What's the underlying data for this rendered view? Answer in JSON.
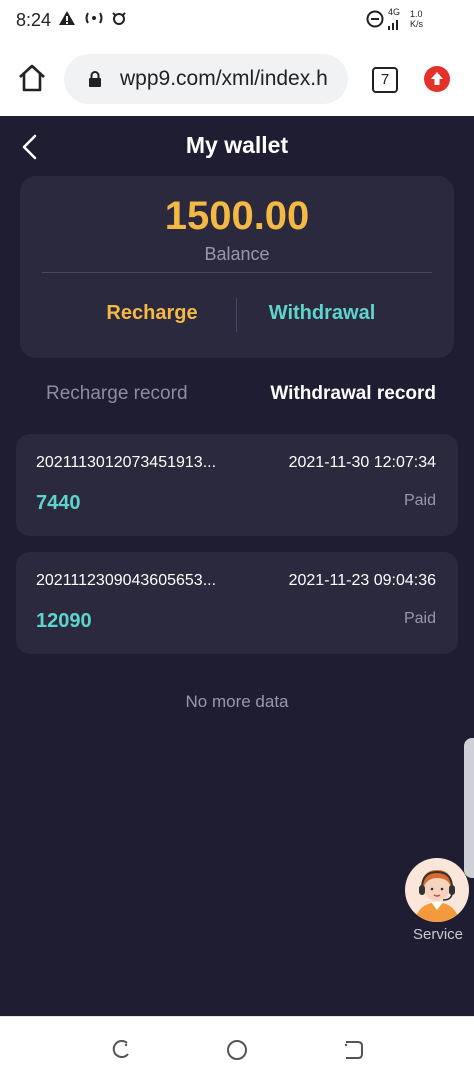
{
  "status_bar": {
    "time": "8:24",
    "network_label": "4G",
    "speed_value": "1.0",
    "speed_unit": "K/s"
  },
  "browser": {
    "url": "wpp9.com/xml/index.h",
    "tab_count": "7"
  },
  "header": {
    "title": "My wallet"
  },
  "wallet": {
    "balance": "1500.00",
    "balance_label": "Balance",
    "recharge_label": "Recharge",
    "withdrawal_label": "Withdrawal"
  },
  "tabs": {
    "recharge_record": "Recharge record",
    "withdrawal_record": "Withdrawal record",
    "active": "withdrawal_record"
  },
  "records": [
    {
      "id": "2021113012073451913...",
      "date": "2021-11-30 12:07:34",
      "amount": "7440",
      "status": "Paid"
    },
    {
      "id": "2021112309043605653...",
      "date": "2021-11-23 09:04:36",
      "amount": "12090",
      "status": "Paid"
    }
  ],
  "no_more_text": "No more data",
  "service": {
    "label": "Service"
  },
  "colors": {
    "background": "#1f1d31",
    "card": "#2b293d",
    "gold": "#f4b844",
    "teal": "#5fd4cd",
    "muted": "#9a98a8"
  },
  "icons": {
    "home": "home-icon",
    "lock": "lock-icon",
    "menu": "menu-update-icon",
    "back": "back-chevron-icon",
    "service": "service-agent-icon"
  }
}
